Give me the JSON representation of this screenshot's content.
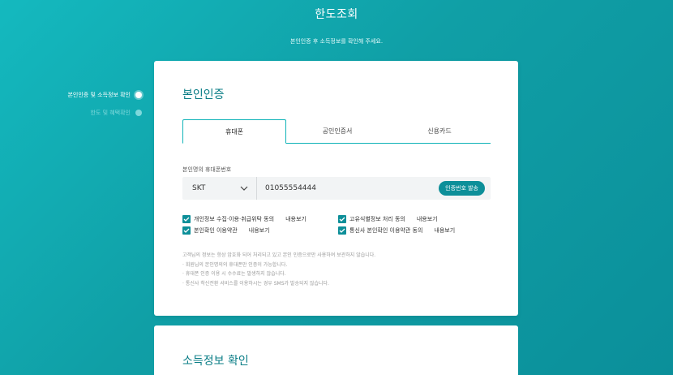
{
  "header": {
    "title": "한도조회",
    "subtitle": "본인인증 후 소득정보를 확인해 주세요."
  },
  "steps": [
    {
      "label": "본인인증 및 소득정보 확인",
      "active": true
    },
    {
      "label": "한도 및 혜택확인",
      "active": false
    }
  ],
  "auth_card": {
    "title": "본인인증",
    "tabs": [
      {
        "label": "휴대폰",
        "active": true
      },
      {
        "label": "공인인증서",
        "active": false
      },
      {
        "label": "신용카드",
        "active": false
      }
    ],
    "phone_label": "본인명의 휴대폰번호",
    "carrier": "SKT",
    "phone_value": "01055554444",
    "send_button": "인증번호 발송",
    "agreements": [
      {
        "text": "개인정보 수집·이용·취급위탁 동의",
        "link": "내용보기",
        "checked": true
      },
      {
        "text": "고유식별정보 처리 동의",
        "link": "내용보기",
        "checked": true
      },
      {
        "text": "본인확인 이용약관",
        "link": "내용보기",
        "checked": true
      },
      {
        "text": "통신사 본인확인 이용약관 동의",
        "link": "내용보기",
        "checked": true
      }
    ],
    "notes": [
      "고객님의 정보는 항상 암호화 되어 처리되고 있고 본인 인증으로만 사용하여 보관하지 않습니다.",
      "· 회원님의 본인명의의 휴대폰만 인증이 가능합니다.",
      "· 휴대폰 인증 이용 시 수수료는 발생하지 않습니다.",
      "· 통신사 착신전환 서비스를 이용하시는 경우 SMS가 발송되지 않습니다."
    ]
  },
  "income_card": {
    "title": "소득정보 확인"
  },
  "colors": {
    "accent": "#0d8f99",
    "background": "#12aab1"
  }
}
